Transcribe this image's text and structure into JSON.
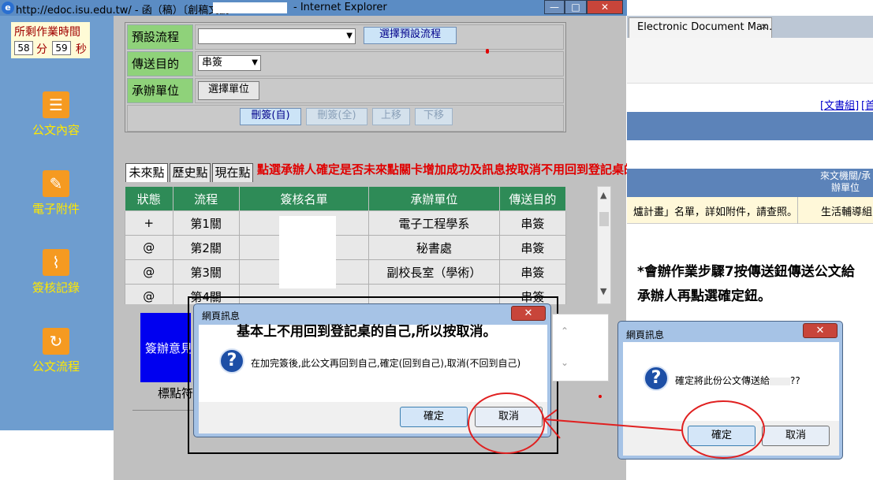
{
  "window": {
    "ie_badge": "e",
    "url_title": "http://edoc.isu.edu.tw/ - 函（稿）〔創稿文號",
    "app_suffix": "- Internet Explorer",
    "min_btn": "—",
    "max_btn": "□",
    "close_btn": "✕"
  },
  "timer": {
    "label": "所剩作業時間",
    "minutes": "58",
    "minutes_unit": "分",
    "seconds": "59",
    "seconds_unit": "秒"
  },
  "sidebar": {
    "items": [
      {
        "label": "公文內容",
        "icon": "document-icon",
        "glyph": "☰"
      },
      {
        "label": "電子附件",
        "icon": "attachment-icon",
        "glyph": "✎"
      },
      {
        "label": "簽核記錄",
        "icon": "key-icon",
        "glyph": "⌇"
      },
      {
        "label": "公文流程",
        "icon": "refresh-icon",
        "glyph": "↻"
      }
    ]
  },
  "form": {
    "preset_flow_label": "預設流程",
    "preset_flow_value": "",
    "preset_flow_button": "選擇預設流程",
    "send_purpose_label": "傳送目的",
    "send_purpose_value": "串簽",
    "unit_label": "承辦單位",
    "unit_button": "選擇單位",
    "delete_self_button": "刪簽(自)",
    "delete_all_button": "刪簽(全)",
    "move_up_button": "上移",
    "move_down_button": "下移"
  },
  "tabs": {
    "future": "未來點",
    "history": "歷史點",
    "current": "現在點"
  },
  "annotation_top": "點選承辦人確定是否未來點關卡增加成功及訊息按取消不用回到登記桌的關卡",
  "sign_table": {
    "headers": [
      "狀態",
      "流程",
      "簽核名單",
      "承辦單位",
      "傳送目的"
    ],
    "rows": [
      {
        "status": "+",
        "flow": "第1關",
        "list": "",
        "unit": "電子工程學系",
        "purpose": "串簽"
      },
      {
        "status": "@",
        "flow": "第2關",
        "list": "",
        "unit": "秘書處",
        "purpose": "串簽"
      },
      {
        "status": "@",
        "flow": "第3關",
        "list": "",
        "unit": "副校長室（學術）",
        "purpose": "串簽"
      },
      {
        "status": "@",
        "flow": "第4關",
        "list": "",
        "unit": "",
        "purpose": "串簽"
      }
    ]
  },
  "opinion_box": "簽辦意見",
  "below_label": "標點符",
  "right_browser": {
    "tab_title": "Electronic Document Man...",
    "tab_close": "✕",
    "link1": "[文書組]",
    "link2": "[首",
    "col_header": "來文機關/承辦單位",
    "row_text": "爐計畫」名單，詳如附件，請查照。",
    "row_unit": "生活輔導組",
    "instruction": "*會辦作業步驟7按傳送鈕傳送公文給承辦人再點選確定鈕。"
  },
  "dialog_left": {
    "title": "網頁訊息",
    "annotation": "基本上不用回到登記桌的自己,所以按取消。",
    "message": "在加完簽後,此公文再回到自己,確定(回到自己),取消(不回到自己)",
    "ok": "確定",
    "cancel": "取消"
  },
  "dialog_right": {
    "title": "網頁訊息",
    "message": "確定將此份公文傳送給",
    "message_tail": "??",
    "ok": "確定",
    "cancel": "取消"
  },
  "colors": {
    "sidebar_bg": "#6e9dcf",
    "form_label_green": "#8fd27a",
    "table_header_green": "#2e8b57",
    "annotation_red": "#e00000",
    "nav_yellow": "#ffe800"
  }
}
